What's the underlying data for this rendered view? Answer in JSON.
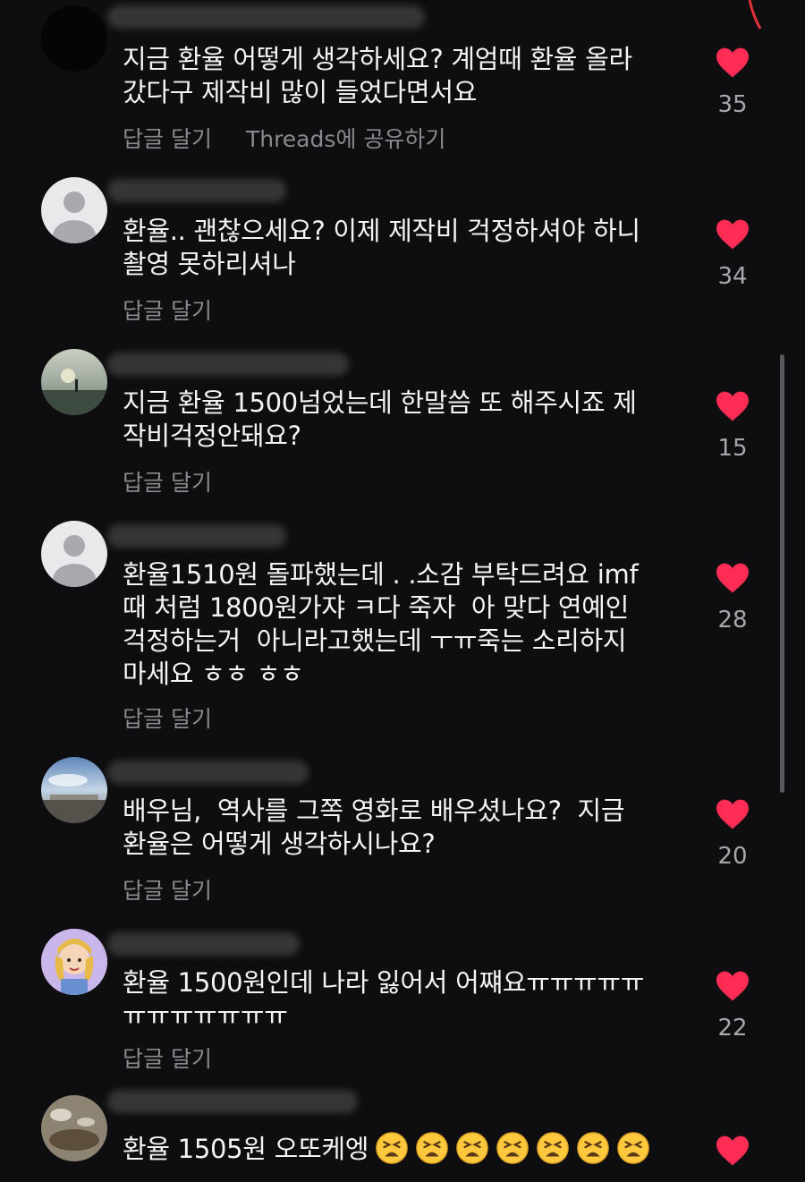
{
  "colors": {
    "background": "#0e0e10",
    "heart": "#ff2d55",
    "muted_text": "#8a8a8e"
  },
  "actions": {
    "reply": "답글 달기",
    "share_threads": "Threads에 공유하기"
  },
  "comments": [
    {
      "text": "지금 환율 어떻게 생각하세요? 계엄때 환율 올라\n갔다구 제작비 많이 들었다면서요",
      "likes": "35",
      "avatar": "dark-avatar"
    },
    {
      "text": "환율.. 괜찮으세요? 이제 제작비 걱정하셔야 하니\n촬영 못하리셔나",
      "likes": "34",
      "avatar": "default-avatar"
    },
    {
      "text": "지금 환율 1500넘었는데 한말씀 또 해주시죠 제\n작비걱정안돼요?",
      "likes": "15",
      "avatar": "beach-avatar"
    },
    {
      "text": "환율1510원 돌파했는데 . .소감 부탁드려요 imf\n때 처럼 1800원가쟈 ㅋ다 죽자  아 맞다 연예인\n걱정하는거  아니라고했는데 ㅜㅠ죽는 소리하지\n마세요 ㅎㅎ ㅎㅎ",
      "likes": "28",
      "avatar": "default-avatar"
    },
    {
      "text": "배우님,  역사를 그쪽 영화로 배우셨나요?  지금\n환율은 어떻게 생각하시나요?",
      "likes": "20",
      "avatar": "sky-avatar"
    },
    {
      "text": "환율 1500원인데 나라 잃어서 어쨰요ㅠㅠㅠㅠㅠ\nㅠㅠㅠㅠㅠㅠㅠ",
      "likes": "22",
      "avatar": "cartoon-avatar"
    },
    {
      "text": "환율 1505원 오또케엥",
      "likes": "",
      "avatar": "sand-avatar",
      "emoji": "tired-face-emoji",
      "emoji_count": 7
    }
  ]
}
